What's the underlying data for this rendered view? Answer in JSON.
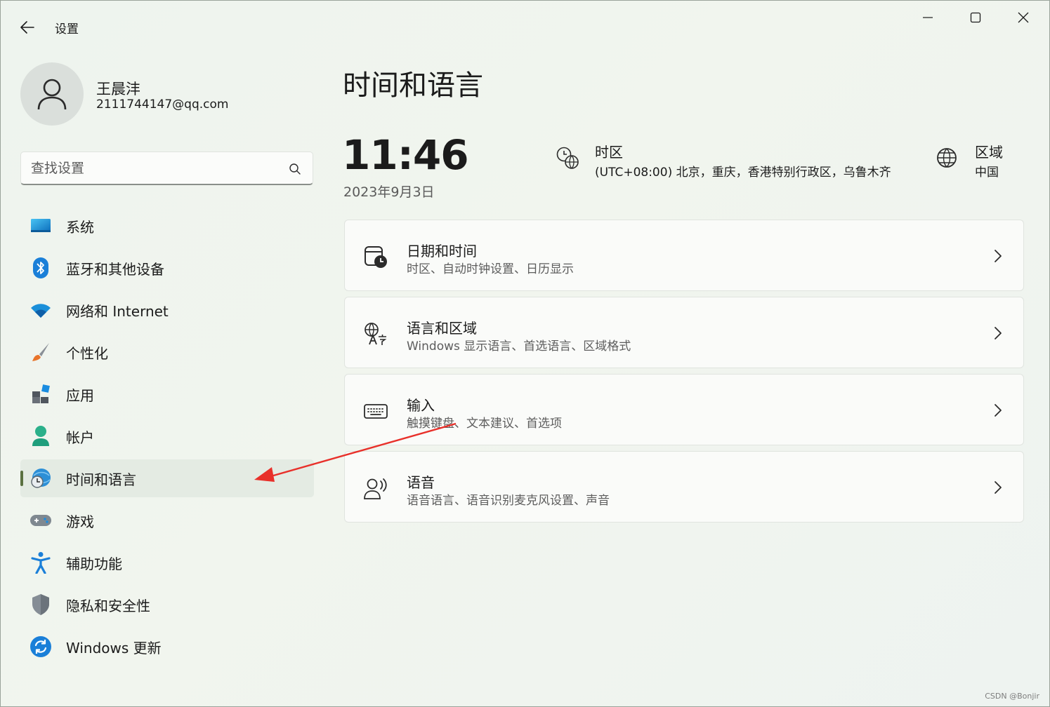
{
  "window": {
    "title": "设置",
    "controls": [
      "minimize",
      "maximize",
      "close"
    ]
  },
  "profile": {
    "name": "王晨沣",
    "email": "2111744147@qq.com"
  },
  "search": {
    "placeholder": "查找设置",
    "value": ""
  },
  "sidebar": {
    "items": [
      {
        "label": "系统",
        "icon": "monitor-icon",
        "selected": false
      },
      {
        "label": "蓝牙和其他设备",
        "icon": "bluetooth-icon",
        "selected": false
      },
      {
        "label": "网络和 Internet",
        "icon": "wifi-icon",
        "selected": false
      },
      {
        "label": "个性化",
        "icon": "brush-icon",
        "selected": false
      },
      {
        "label": "应用",
        "icon": "apps-icon",
        "selected": false
      },
      {
        "label": "帐户",
        "icon": "account-icon",
        "selected": false
      },
      {
        "label": "时间和语言",
        "icon": "globe-clock-icon",
        "selected": true
      },
      {
        "label": "游戏",
        "icon": "gamepad-icon",
        "selected": false
      },
      {
        "label": "辅助功能",
        "icon": "accessibility-icon",
        "selected": false
      },
      {
        "label": "隐私和安全性",
        "icon": "shield-icon",
        "selected": false
      },
      {
        "label": "Windows 更新",
        "icon": "update-icon",
        "selected": false
      }
    ]
  },
  "main": {
    "title": "时间和语言",
    "clock": "11:46",
    "date": "2023年9月3日",
    "timezone": {
      "title": "时区",
      "value": "(UTC+08:00) 北京，重庆，香港特别行政区，乌鲁木齐"
    },
    "region": {
      "title": "区域",
      "value": "中国"
    },
    "cards": [
      {
        "title": "日期和时间",
        "subtitle": "时区、自动时钟设置、日历显示",
        "icon": "calendar-clock-icon"
      },
      {
        "title": "语言和区域",
        "subtitle": "Windows 显示语言、首选语言、区域格式",
        "icon": "language-icon"
      },
      {
        "title": "输入",
        "subtitle": "触摸键盘、文本建议、首选项",
        "icon": "keyboard-icon"
      },
      {
        "title": "语音",
        "subtitle": "语音语言、语音识别麦克风设置、声音",
        "icon": "speech-icon"
      }
    ]
  },
  "annotation": {
    "color": "#e8302a"
  },
  "watermark": "CSDN @Bonjir",
  "colors": {
    "accent": "#5b7141",
    "background": "#eef3ec"
  }
}
